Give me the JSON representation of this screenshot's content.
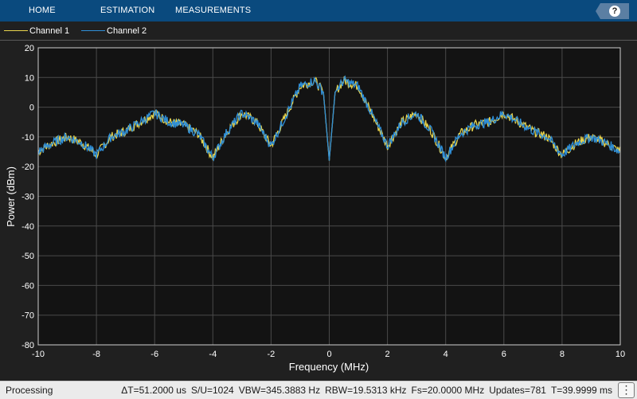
{
  "toolbar": {
    "tabs": [
      {
        "label": "HOME"
      },
      {
        "label": "ESTIMATION"
      },
      {
        "label": "MEASUREMENTS"
      }
    ],
    "help_icon": "question-mark-icon",
    "help_label": "?"
  },
  "legend": {
    "items": [
      {
        "label": "Channel 1",
        "color": "#e8d44d"
      },
      {
        "label": "Channel 2",
        "color": "#2f8fd8"
      }
    ]
  },
  "colors": {
    "toolbar_bg": "#0a4a7e",
    "figure_bg": "#202020",
    "axes_bg": "#131313",
    "grid": "#4a4a4a",
    "text": "#ffffff"
  },
  "chart_data": {
    "type": "line",
    "xlabel": "Frequency (MHz)",
    "ylabel": "Power (dBm)",
    "xlim": [
      -10,
      10
    ],
    "ylim": [
      -80,
      20
    ],
    "x_ticks": [
      -10,
      -8,
      -6,
      -4,
      -2,
      0,
      2,
      4,
      6,
      8,
      10
    ],
    "y_ticks": [
      20,
      10,
      0,
      -10,
      -20,
      -30,
      -40,
      -50,
      -60,
      -70,
      -80
    ],
    "grid": true,
    "legend_position": "top-left",
    "series": [
      {
        "name": "Channel 1",
        "color": "#e8d44d",
        "x": [
          -10,
          -9.5,
          -9,
          -8.5,
          -8,
          -7.5,
          -7,
          -6.5,
          -6,
          -5.5,
          -5,
          -4.5,
          -4,
          -3.5,
          -3,
          -2.5,
          -2,
          -1.5,
          -1,
          -0.5,
          -0.2,
          0,
          0.2,
          0.5,
          1,
          1.5,
          2,
          2.5,
          3,
          3.5,
          4,
          4.5,
          5,
          5.5,
          6,
          6.5,
          7,
          7.5,
          8,
          8.5,
          9,
          9.5,
          10
        ],
        "y": [
          -15,
          -12,
          -10,
          -12,
          -16,
          -10,
          -8,
          -5,
          -2,
          -5,
          -6,
          -9,
          -17,
          -8,
          -2,
          -5,
          -13,
          -3,
          7,
          9,
          5,
          -18,
          5,
          9,
          7,
          -3,
          -13,
          -5,
          -2,
          -8,
          -17,
          -9,
          -6,
          -5,
          -2,
          -5,
          -8,
          -10,
          -16,
          -12,
          -10,
          -12,
          -15
        ]
      },
      {
        "name": "Channel 2",
        "color": "#2f8fd8",
        "x": [
          -10,
          -9.5,
          -9,
          -8.5,
          -8,
          -7.5,
          -7,
          -6.5,
          -6,
          -5.5,
          -5,
          -4.5,
          -4,
          -3.5,
          -3,
          -2.5,
          -2,
          -1.5,
          -1,
          -0.5,
          -0.2,
          0,
          0.2,
          0.5,
          1,
          1.5,
          2,
          2.5,
          3,
          3.5,
          4,
          4.5,
          5,
          5.5,
          6,
          6.5,
          7,
          7.5,
          8,
          8.5,
          9,
          9.5,
          10
        ],
        "y": [
          -15,
          -12,
          -10,
          -12,
          -16,
          -10,
          -8,
          -5,
          -2,
          -5,
          -6,
          -9,
          -17,
          -8,
          -2,
          -5,
          -13,
          -3,
          7,
          9,
          5,
          -18,
          5,
          9,
          7,
          -3,
          -13,
          -5,
          -2,
          -8,
          -17,
          -9,
          -6,
          -5,
          -2,
          -5,
          -8,
          -10,
          -16,
          -12,
          -10,
          -12,
          -15
        ]
      }
    ]
  },
  "status": {
    "state": "Processing",
    "delta_t": "ΔT=51.2000 us",
    "su": "S/U=1024",
    "vbw": "VBW=345.3883 Hz",
    "rbw": "RBW=19.5313 kHz",
    "fs": "Fs=20.0000 MHz",
    "updates": "Updates=781",
    "t": "T=39.9999 ms",
    "more_icon": "more-vertical-icon",
    "more_label": "⋮"
  }
}
